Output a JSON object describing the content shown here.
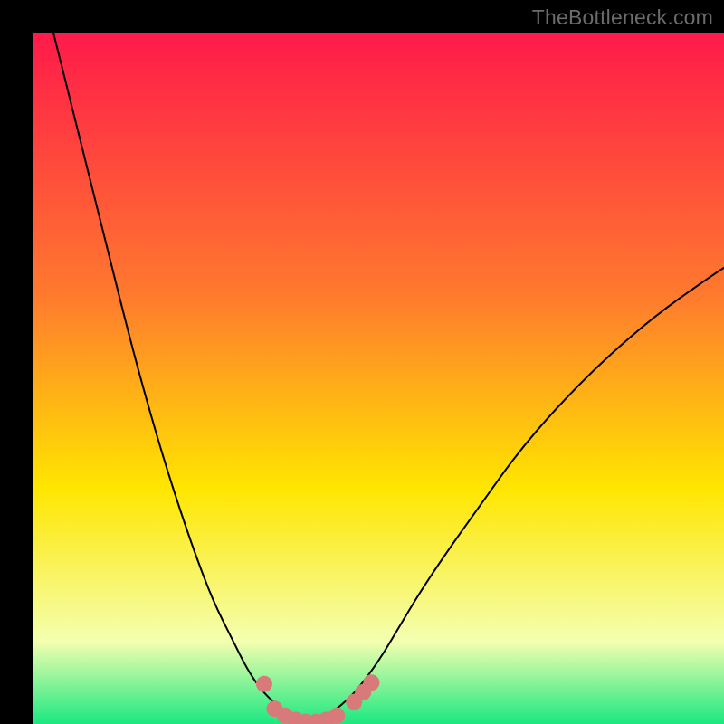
{
  "watermark": "TheBottleneck.com",
  "chart_data": {
    "type": "line",
    "title": "",
    "xlabel": "",
    "ylabel": "",
    "xlim": [
      0,
      100
    ],
    "ylim": [
      0,
      100
    ],
    "background_gradient": {
      "top": "#ff1a4a",
      "mid_upper": "#ff7a2e",
      "mid": "#ffe600",
      "lower": "#f4ffb0",
      "bottom": "#1be880"
    },
    "series": [
      {
        "name": "bottleneck-curve",
        "color": "#000000",
        "x": [
          3,
          5,
          8,
          11,
          14,
          17,
          20,
          23,
          26,
          29,
          31,
          33,
          35,
          37,
          38.5,
          40,
          41.5,
          43,
          45,
          47,
          50,
          53,
          56,
          60,
          65,
          70,
          76,
          83,
          90,
          97,
          100
        ],
        "y": [
          100,
          92,
          80,
          68,
          56,
          45,
          35,
          26,
          18,
          12,
          8,
          5,
          3,
          1.5,
          0.7,
          0.3,
          0.7,
          1.5,
          3,
          5,
          9,
          14,
          19,
          25,
          32,
          39,
          46,
          53,
          59,
          64,
          66
        ]
      }
    ],
    "markers": {
      "name": "highlight-dots",
      "color": "#d87a7a",
      "radius": 9,
      "points": [
        {
          "x": 33.5,
          "y": 5.8
        },
        {
          "x": 35.0,
          "y": 2.2
        },
        {
          "x": 36.5,
          "y": 1.2
        },
        {
          "x": 38.0,
          "y": 0.6
        },
        {
          "x": 39.5,
          "y": 0.3
        },
        {
          "x": 41.0,
          "y": 0.3
        },
        {
          "x": 42.5,
          "y": 0.6
        },
        {
          "x": 44.0,
          "y": 1.2
        },
        {
          "x": 46.5,
          "y": 3.2
        },
        {
          "x": 47.8,
          "y": 4.6
        },
        {
          "x": 49.0,
          "y": 6.0
        }
      ]
    }
  }
}
